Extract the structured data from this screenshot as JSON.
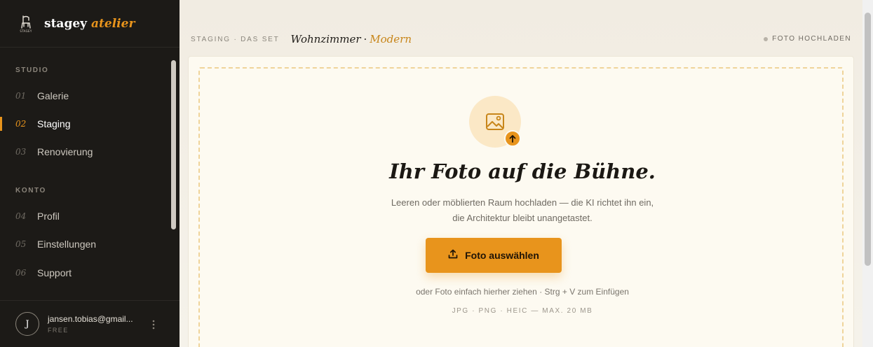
{
  "brand": {
    "logo_text": "STAGEY",
    "name": "stagey",
    "accent": "atelier"
  },
  "sidebar": {
    "sections": [
      {
        "label": "STUDIO",
        "items": [
          {
            "num": "01",
            "label": "Galerie",
            "active": false
          },
          {
            "num": "02",
            "label": "Staging",
            "active": true
          },
          {
            "num": "03",
            "label": "Renovierung",
            "active": false
          }
        ]
      },
      {
        "label": "KONTO",
        "items": [
          {
            "num": "04",
            "label": "Profil",
            "active": false
          },
          {
            "num": "05",
            "label": "Einstellungen",
            "active": false
          },
          {
            "num": "06",
            "label": "Support",
            "active": false
          }
        ]
      }
    ],
    "account": {
      "initial": "J",
      "email": "jansen.tobias@gmail...",
      "plan": "FREE"
    }
  },
  "header": {
    "crumb": "STAGING · DAS SET",
    "room": "Wohnzimmer",
    "separator": "·",
    "style": "Modern",
    "status": "FOTO HOCHLADEN"
  },
  "dropzone": {
    "headline": "Ihr Foto auf die Bühne.",
    "sub_line1": "Leeren oder möblierten Raum hochladen — die KI richtet ihn ein,",
    "sub_line2": "die Architektur bleibt unangetastet.",
    "button_label": "Foto auswählen",
    "hint": "oder Foto einfach hierher ziehen · Strg + V zum Einfügen",
    "formats": "JPG · PNG · HEIC — MAX. 20 MB"
  },
  "colors": {
    "accent": "#e8941c",
    "sidebar_bg": "#1c1a17",
    "card_bg": "#fdfaf1"
  },
  "icons": [
    "stagey-chair-logo",
    "image-icon",
    "upload-arrow-icon",
    "upload-icon",
    "kebab-menu-icon"
  ]
}
